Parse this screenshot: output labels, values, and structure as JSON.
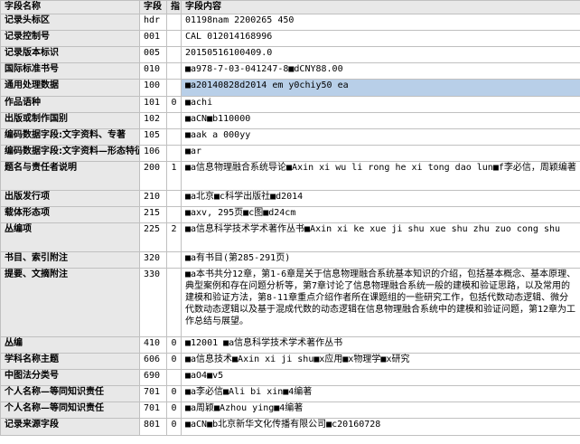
{
  "header": {
    "col_name": "字段名称",
    "col_tag": "字段",
    "col_ind": "指",
    "col_content": "字段内容"
  },
  "rows": [
    {
      "name": "记录头标区",
      "tag": "hdr",
      "ind": "",
      "content": "01198nam  2200265   450"
    },
    {
      "name": "记录控制号",
      "tag": "001",
      "ind": "",
      "content": "CAL 012014168996"
    },
    {
      "name": "记录版本标识",
      "tag": "005",
      "ind": "",
      "content": "20150516100409.0"
    },
    {
      "name": "国际标准书号",
      "tag": "010",
      "ind": "",
      "content": "■a978-7-03-041247-8■dCNY88.00"
    },
    {
      "name": "通用处理数据",
      "tag": "100",
      "ind": "",
      "content": "■a20140828d2014    em y0chiy50      ea",
      "selected": true
    },
    {
      "name": "作品语种",
      "tag": "101",
      "ind": "0",
      "content": "■achi"
    },
    {
      "name": "出版或制作国别",
      "tag": "102",
      "ind": "",
      "content": "■aCN■b110000"
    },
    {
      "name": "编码数据字段:文字资料、专著",
      "tag": "105",
      "ind": "",
      "content": "■aak  a    000yy"
    },
    {
      "name": "编码数据字段:文字资料—形态特征",
      "tag": "106",
      "ind": "",
      "content": "■ar"
    },
    {
      "name": "题名与责任者说明",
      "tag": "200",
      "ind": "1",
      "content": "■a信息物理融合系统导论■Axin xi wu li rong he xi tong dao lun■f李必信，周颖编著"
    },
    {
      "name": "出版发行项",
      "tag": "210",
      "ind": "",
      "content": "■a北京■c科学出版社■d2014"
    },
    {
      "name": "载体形态项",
      "tag": "215",
      "ind": "",
      "content": "■axv, 295页■c图■d24cm"
    },
    {
      "name": "丛编项",
      "tag": "225",
      "ind": "2",
      "content": "■a信息科学技术学术著作丛书■Axin xi ke xue ji shu xue shu zhu zuo cong shu"
    },
    {
      "name": "书目、索引附注",
      "tag": "320",
      "ind": "",
      "content": "■a有书目(第285-291页)"
    },
    {
      "name": "提要、文摘附注",
      "tag": "330",
      "ind": "",
      "content": "■a本书共分12章，第1-6章是关于信息物理融合系统基本知识的介绍，包括基本概念、基本原理、典型案例和存在问题分析等，第7章讨论了信息物理融合系统一般的建模和验证思路，以及常用的建模和验证方法，第8-11章重点介绍作者所在课题组的一些研究工作，包括代数动态逻辑、微分代数动态逻辑以及基于混成代数的动态逻辑在信息物理融合系统中的建模和验证问题，第12章为工作总结与展望。",
      "tall": true
    },
    {
      "name": "丛编",
      "tag": "410",
      "ind": "0",
      "content": "■12001 ■a信息科学技术学术著作丛书"
    },
    {
      "name": "学科名称主题",
      "tag": "606",
      "ind": "0",
      "content": "■a信息技术■Axin xi ji shu■x应用■x物理学■x研究"
    },
    {
      "name": "中图法分类号",
      "tag": "690",
      "ind": "",
      "content": "■aO4■v5"
    },
    {
      "name": "个人名称—等同知识责任",
      "tag": "701",
      "ind": "0",
      "content": "■a李必信■Ali bi xin■4编著"
    },
    {
      "name": "个人名称—等同知识责任",
      "tag": "701",
      "ind": "0",
      "content": "■a周颖■Azhou ying■4编著"
    },
    {
      "name": "记录来源字段",
      "tag": "801",
      "ind": "0",
      "content": "■aCN■b北京新华文化传播有限公司■c20160728"
    }
  ]
}
